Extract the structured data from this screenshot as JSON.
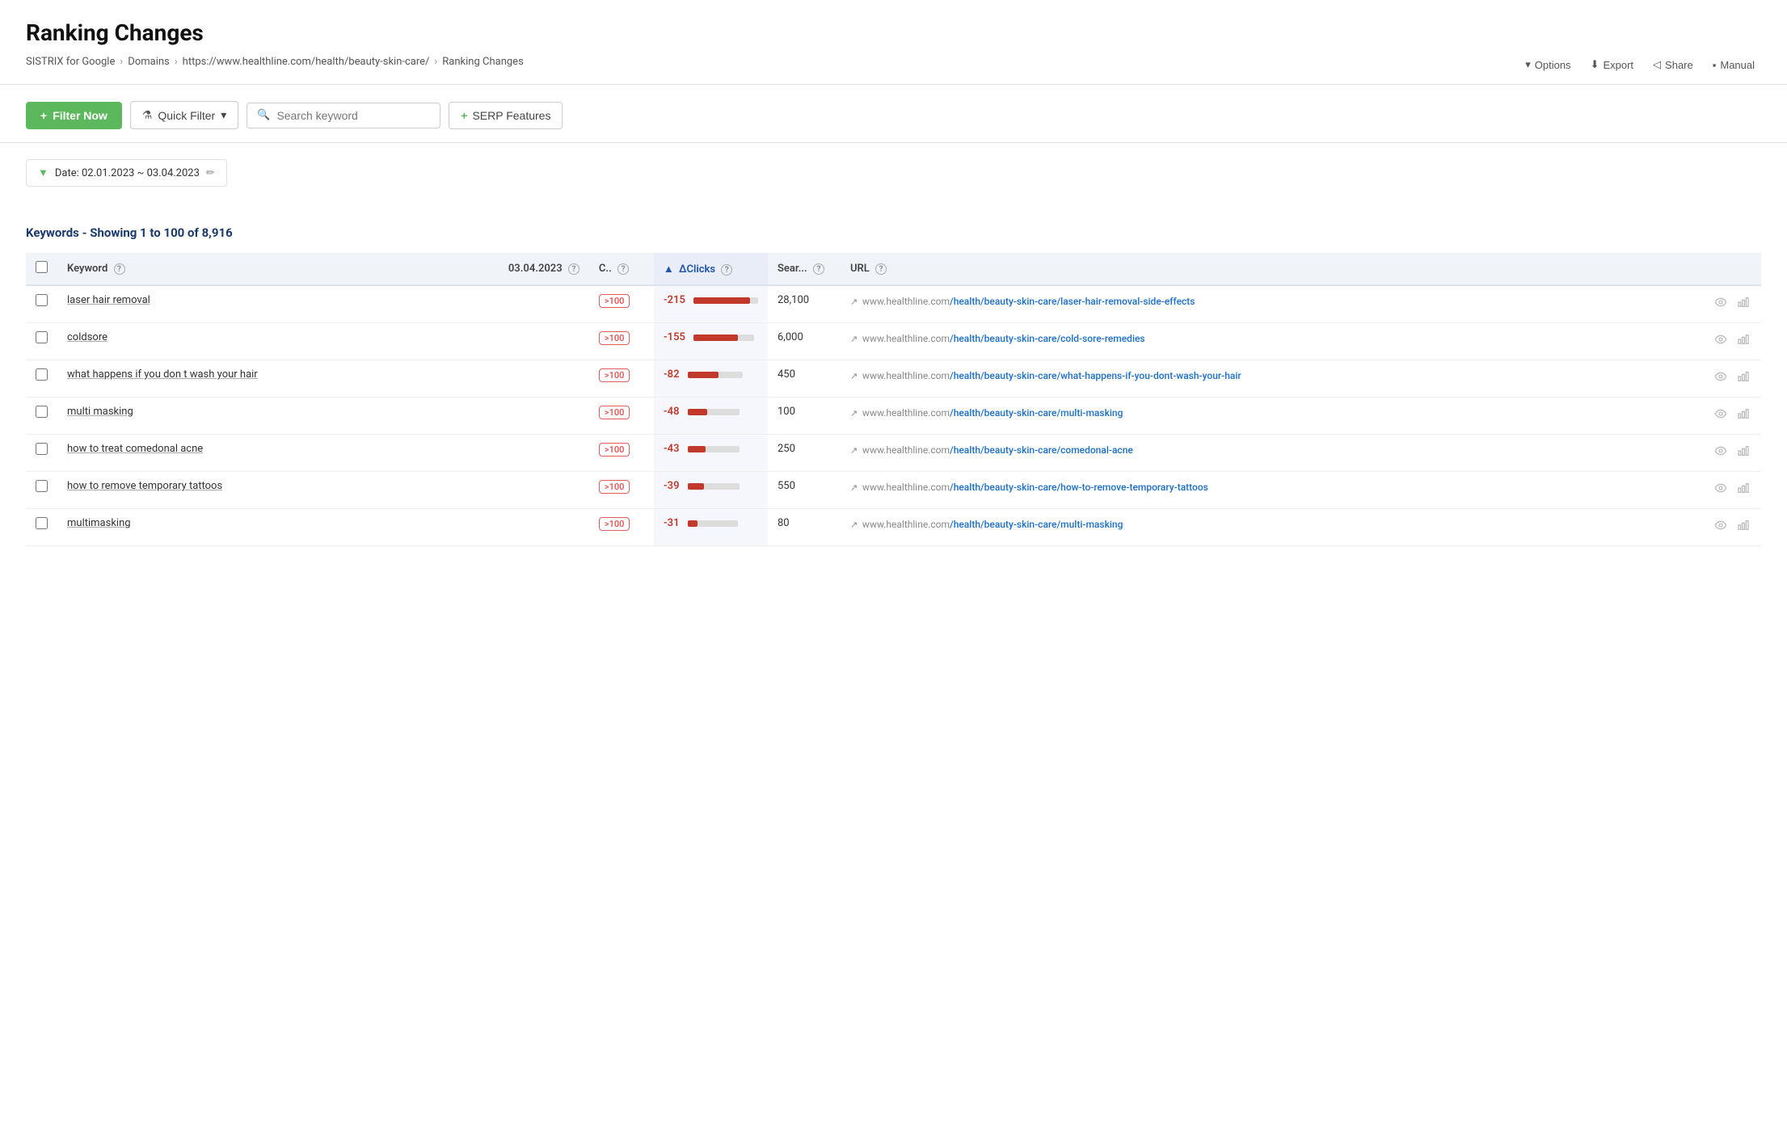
{
  "page": {
    "title": "Ranking Changes",
    "breadcrumb": [
      {
        "label": "SISTRIX for Google",
        "href": "#"
      },
      {
        "label": "Domains",
        "href": "#"
      },
      {
        "label": "https://www.healthline.com/health/beauty-skin-care/",
        "href": "#"
      },
      {
        "label": "Ranking Changes",
        "href": "#"
      }
    ]
  },
  "top_actions": [
    {
      "label": "Options",
      "icon": "chevron-down"
    },
    {
      "label": "Export",
      "icon": "download"
    },
    {
      "label": "Share",
      "icon": "share"
    },
    {
      "label": "Manual",
      "icon": "book"
    }
  ],
  "toolbar": {
    "filter_now_label": "Filter Now",
    "quick_filter_label": "Quick Filter",
    "search_placeholder": "Search keyword",
    "serp_label": "SERP Features"
  },
  "date_filter": {
    "label": "Date: 02.01.2023 ~ 03.04.2023"
  },
  "table": {
    "keywords_header": "Keywords - Showing 1 to 100 of 8,916",
    "columns": [
      {
        "key": "keyword",
        "label": "Keyword"
      },
      {
        "key": "date",
        "label": "03.04.2023"
      },
      {
        "key": "c",
        "label": "C.."
      },
      {
        "key": "delta",
        "label": "ΔClicks"
      },
      {
        "key": "search",
        "label": "Sear..."
      },
      {
        "key": "url",
        "label": "URL"
      }
    ],
    "rows": [
      {
        "keyword": "laser hair removal",
        "date": "",
        "c_badge": ">100",
        "delta": "-215",
        "delta_bar_red": 70,
        "delta_bar_gray": 10,
        "search_vol": "28,100",
        "url_base": "www.healthline.com",
        "url_path": "/health/beauty-skin-care/laser-hair-removal-side-effects"
      },
      {
        "keyword": "coldsore",
        "date": "",
        "c_badge": ">100",
        "delta": "-155",
        "delta_bar_red": 55,
        "delta_bar_gray": 20,
        "search_vol": "6,000",
        "url_base": "www.healthline.com",
        "url_path": "/health/beauty-skin-care/cold-sore-remedies"
      },
      {
        "keyword": "what happens if you don t wash your hair",
        "date": "",
        "c_badge": ">100",
        "delta": "-82",
        "delta_bar_red": 38,
        "delta_bar_gray": 30,
        "search_vol": "450",
        "url_base": "www.healthline.com",
        "url_path": "/health/beauty-skin-care/what-happens-if-you-dont-wash-your-hair"
      },
      {
        "keyword": "multi masking",
        "date": "",
        "c_badge": ">100",
        "delta": "-48",
        "delta_bar_red": 24,
        "delta_bar_gray": 40,
        "search_vol": "100",
        "url_base": "www.healthline.com",
        "url_path": "/health/beauty-skin-care/multi-masking"
      },
      {
        "keyword": "how to treat comedonal acne",
        "date": "",
        "c_badge": ">100",
        "delta": "-43",
        "delta_bar_red": 22,
        "delta_bar_gray": 42,
        "search_vol": "250",
        "url_base": "www.healthline.com",
        "url_path": "/health/beauty-skin-care/comedonal-acne"
      },
      {
        "keyword": "how to remove temporary tattoos",
        "date": "",
        "c_badge": ">100",
        "delta": "-39",
        "delta_bar_red": 20,
        "delta_bar_gray": 44,
        "search_vol": "550",
        "url_base": "www.healthline.com",
        "url_path": "/health/beauty-skin-care/how-to-remove-temporary-tattoos"
      },
      {
        "keyword": "multimasking",
        "date": "",
        "c_badge": ">100",
        "delta": "-31",
        "delta_bar_red": 12,
        "delta_bar_gray": 50,
        "search_vol": "80",
        "url_base": "www.healthline.com",
        "url_path": "/health/beauty-skin-care/multi-masking"
      }
    ]
  },
  "icons": {
    "plus": "+",
    "funnel": "▼",
    "search": "🔍",
    "pencil": "✏",
    "eye": "👁",
    "chart": "📊",
    "external": "↗",
    "download": "⬇",
    "share": "◁",
    "book": "▪",
    "chevron": "▾"
  },
  "colors": {
    "green": "#5cb85c",
    "red": "#c0392b",
    "badge_red": "#e05c5c",
    "blue": "#1a6ec8",
    "dark_blue": "#1a3a6e",
    "highlight_blue": "#e8edf8"
  }
}
